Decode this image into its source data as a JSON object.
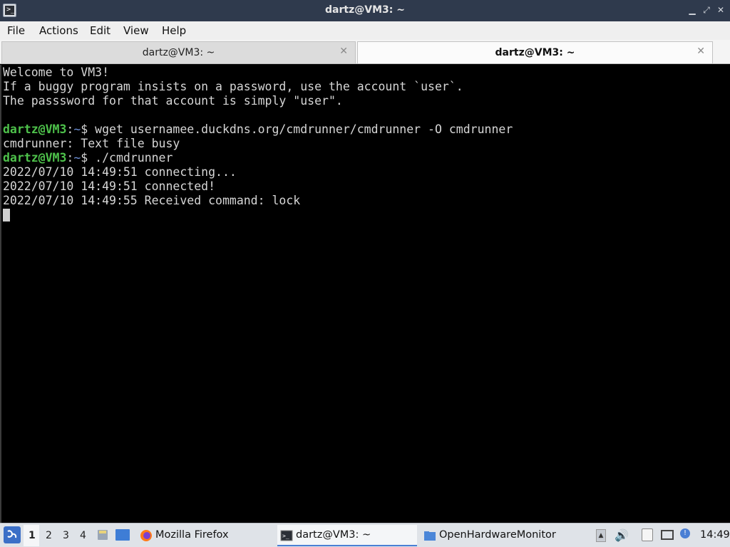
{
  "window": {
    "title": "dartz@VM3: ~",
    "controls": [
      "minimize",
      "maximize",
      "close"
    ]
  },
  "menu": {
    "items": [
      "File",
      "Actions",
      "Edit",
      "View",
      "Help"
    ]
  },
  "tabs": [
    {
      "label": "dartz@VM3: ~",
      "active": false
    },
    {
      "label": "dartz@VM3: ~",
      "active": true
    }
  ],
  "terminal": {
    "lines": [
      {
        "text": "Welcome to VM3!"
      },
      {
        "text": "If a buggy program insists on a password, use the account `user`."
      },
      {
        "text": "The passsword for that account is simply \"user\"."
      },
      {
        "text": ""
      },
      {
        "prompt_user": "dartz@VM3",
        "prompt_sep": ":",
        "prompt_path": "~",
        "prompt_sym": "$ ",
        "command": "wget usernamee.duckdns.org/cmdrunner/cmdrunner -O cmdrunner"
      },
      {
        "text": "cmdrunner: Text file busy"
      },
      {
        "prompt_user": "dartz@VM3",
        "prompt_sep": ":",
        "prompt_path": "~",
        "prompt_sym": "$ ",
        "command": "./cmdrunner"
      },
      {
        "text": "2022/07/10 14:49:51 connecting..."
      },
      {
        "text": "2022/07/10 14:49:51 connected!"
      },
      {
        "text": "2022/07/10 14:49:55 Received command: lock"
      }
    ]
  },
  "taskbar": {
    "workspaces": [
      "1",
      "2",
      "3",
      "4"
    ],
    "active_workspace": "1",
    "tasks": [
      {
        "label": "Mozilla Firefox",
        "icon": "firefox-icon"
      },
      {
        "label": "dartz@VM3: ~",
        "icon": "terminal-icon"
      },
      {
        "label": "OpenHardwareMonitor",
        "icon": "folder-icon"
      }
    ],
    "clock": "14:49"
  },
  "colors": {
    "titlebar": "#2f3a4d",
    "prompt_user": "#4ec24b",
    "prompt_path": "#6c8fd6",
    "taskbar": "#dfe3e8"
  }
}
